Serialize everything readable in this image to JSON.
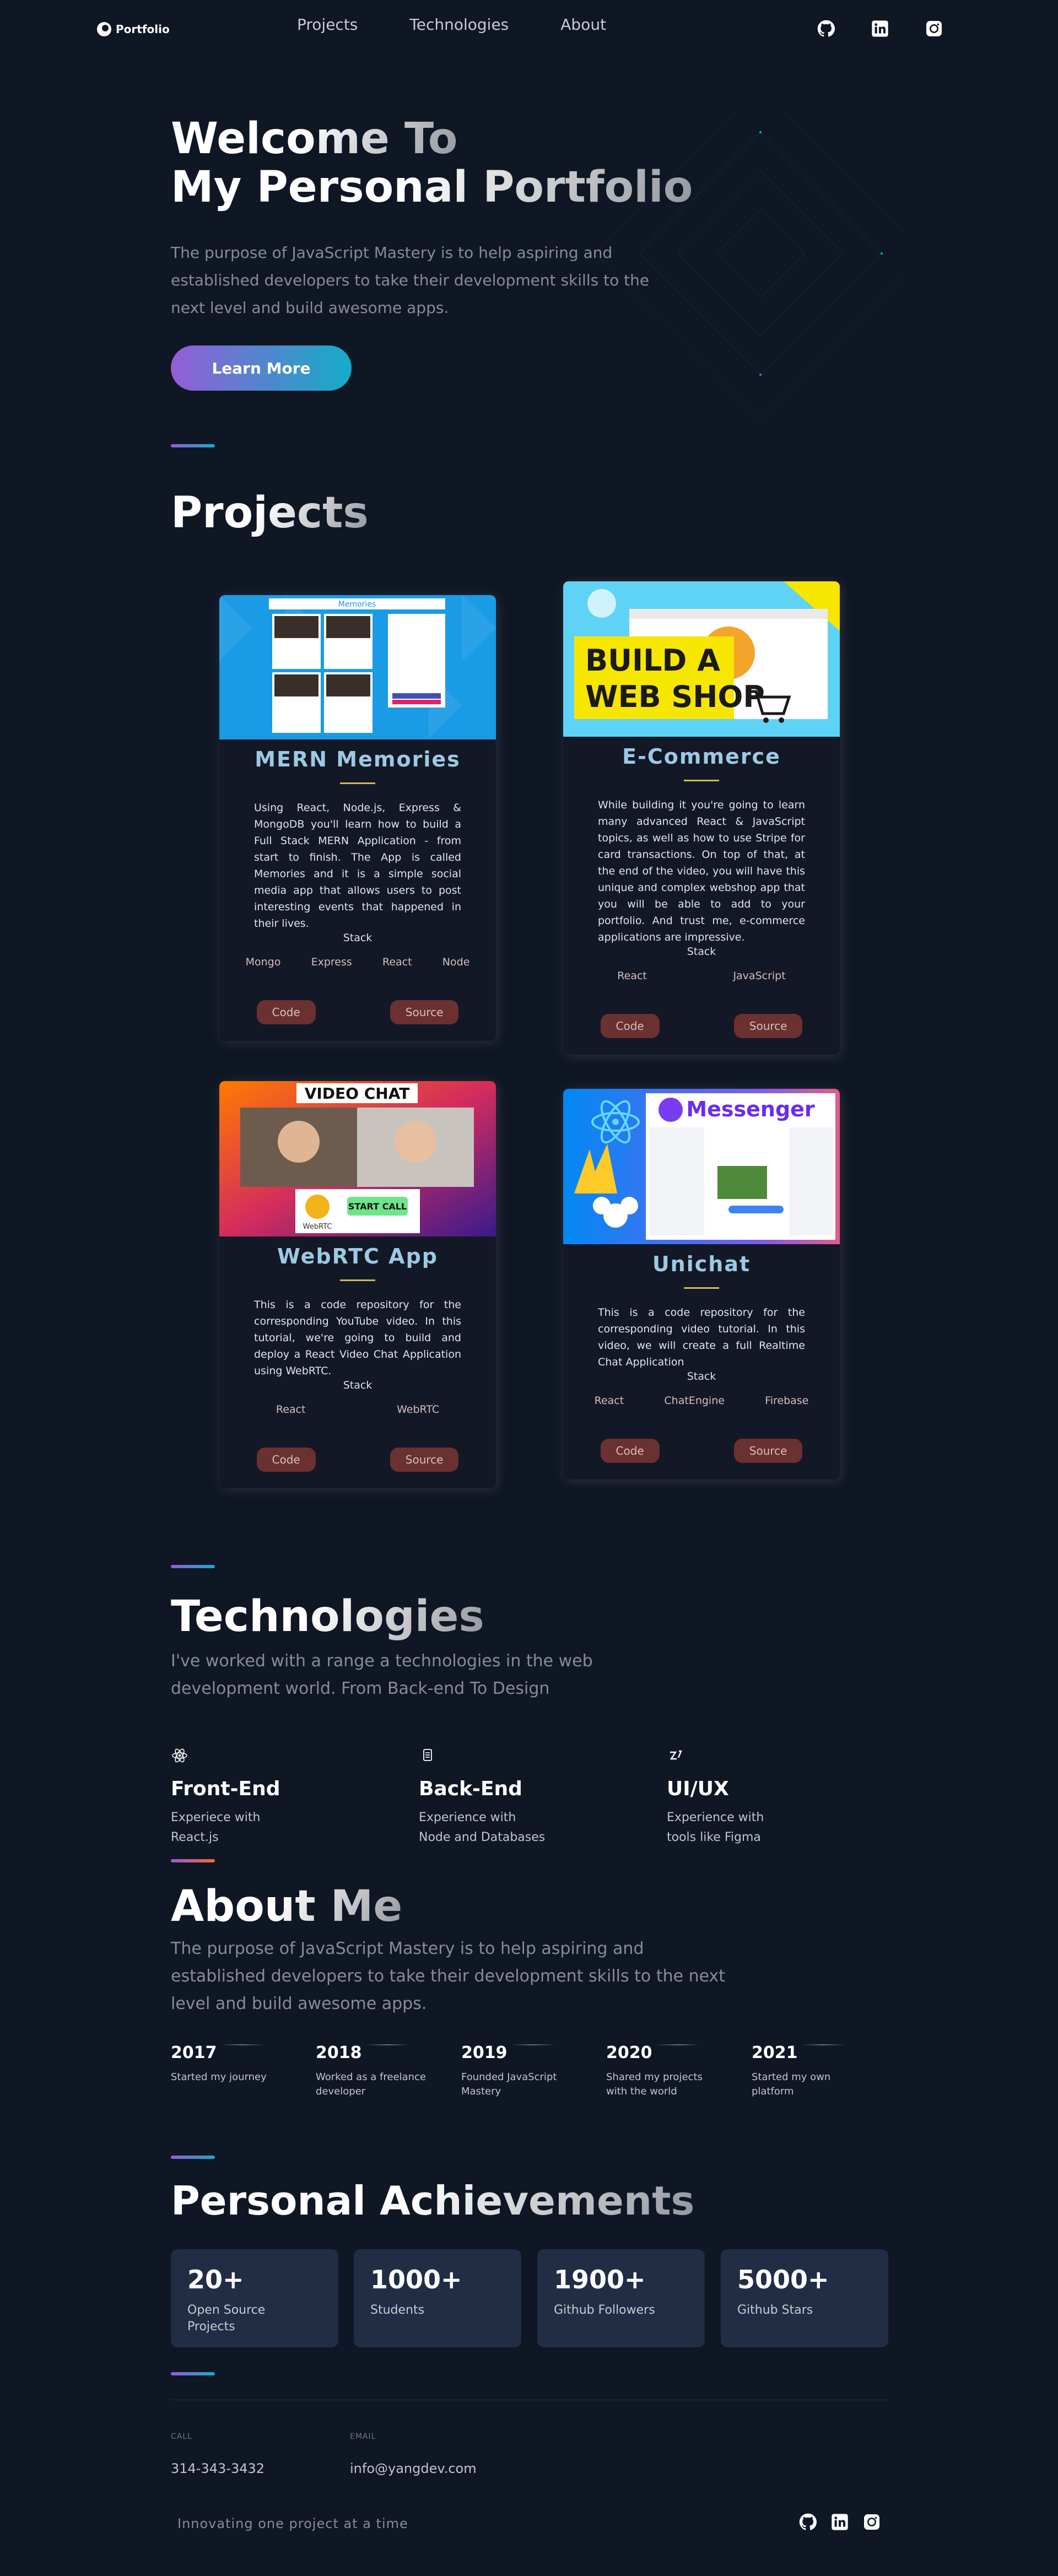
{
  "nav": {
    "logo_text": "Portfolio",
    "links": [
      "Projects",
      "Technologies",
      "About"
    ]
  },
  "social_icons": [
    "github-icon",
    "linkedin-icon",
    "instagram-icon"
  ],
  "hero": {
    "title_line1": "Welcome To",
    "title_line2": "My Personal Portfolio",
    "text": "The purpose of JavaScript Mastery is to help aspiring and established developers to take their development skills to the next level and build awesome apps.",
    "button_label": "Learn More"
  },
  "projects": {
    "title": "Projects",
    "items": [
      {
        "title": "MERN Memories",
        "image_text": "Memories",
        "description": "Using React, Node.js, Express & MongoDB you'll learn how to build a Full Stack MERN Application - from start to finish. The App is called Memories and it is a simple social media app that allows users to post interesting events that happened in their lives.",
        "stack_label": "Stack",
        "tags": [
          "Mongo",
          "Express",
          "React",
          "Node"
        ],
        "code_label": "Code",
        "source_label": "Source"
      },
      {
        "title": "E-Commerce",
        "image_text_line1": "BUILD A",
        "image_text_line2": "WEB SHOP",
        "description": "While building it you're going to learn many advanced React & JavaScript topics, as well as how to use Stripe for card transactions. On top of that, at the end of the video, you will have this unique and complex webshop app that you will be able to add to your portfolio. And trust me, e-commerce applications are impressive.",
        "stack_label": "Stack",
        "tags": [
          "React",
          "JavaScript"
        ],
        "code_label": "Code",
        "source_label": "Source"
      },
      {
        "title": "WebRTC App",
        "image_text": "VIDEO CHAT",
        "image_button": "START CALL",
        "image_logo": "WebRTC",
        "description": "This is a code repository for the corresponding YouTube video. In this tutorial, we're going to build and deploy a React Video Chat Application using WebRTC.",
        "stack_label": "Stack",
        "tags": [
          "React",
          "WebRTC"
        ],
        "code_label": "Code",
        "source_label": "Source"
      },
      {
        "title": "Unichat",
        "image_text": "Messenger",
        "description": "This is a code repository for the corresponding video tutorial. In this video, we will create a full Realtime Chat Application",
        "stack_label": "Stack",
        "tags": [
          "React",
          "ChatEngine",
          "Firebase"
        ],
        "code_label": "Code",
        "source_label": "Source"
      }
    ]
  },
  "technologies": {
    "title": "Technologies",
    "text": "I've worked with a range a technologies in the web development world. From Back-end To Design",
    "items": [
      {
        "icon": "react-icon",
        "title": "Front-End",
        "line1": "Experiece with",
        "line2": "React.js"
      },
      {
        "icon": "database-icon",
        "title": "Back-End",
        "line1": "Experience with",
        "line2": "Node and Databases"
      },
      {
        "icon": "zeplin-icon",
        "title": "UI/UX",
        "line1": "Experience with",
        "line2": "tools like Figma"
      }
    ]
  },
  "about": {
    "title": "About Me",
    "text": "The purpose of JavaScript Mastery is to help aspiring and established developers to take their development skills to the next level and build awesome apps.",
    "timeline": [
      {
        "year": "2017",
        "text": "Started my journey"
      },
      {
        "year": "2018",
        "text": "Worked as a freelance developer"
      },
      {
        "year": "2019",
        "text": "Founded JavaScript Mastery"
      },
      {
        "year": "2020",
        "text": "Shared my projects with the world"
      },
      {
        "year": "2021",
        "text": "Started my own platform"
      }
    ]
  },
  "achievements": {
    "title": "Personal Achievements",
    "items": [
      {
        "number": "20+",
        "label": "Open Source Projects"
      },
      {
        "number": "1000+",
        "label": "Students"
      },
      {
        "number": "1900+",
        "label": "Github Followers"
      },
      {
        "number": "5000+",
        "label": "Github Stars"
      }
    ]
  },
  "footer": {
    "call_label": "CALL",
    "call_value": "314-343-3432",
    "email_label": "EMAIL",
    "email_value": "info@yangdev.com",
    "slogan": "Innovating one project at a time"
  },
  "colors": {
    "background": "#0f1624",
    "accent_gradient_start": "#945dd6",
    "accent_gradient_end": "#13adc7",
    "card_title": "#9cc9e3",
    "card_button": "#6b3030",
    "achievement_box": "#212d45"
  }
}
